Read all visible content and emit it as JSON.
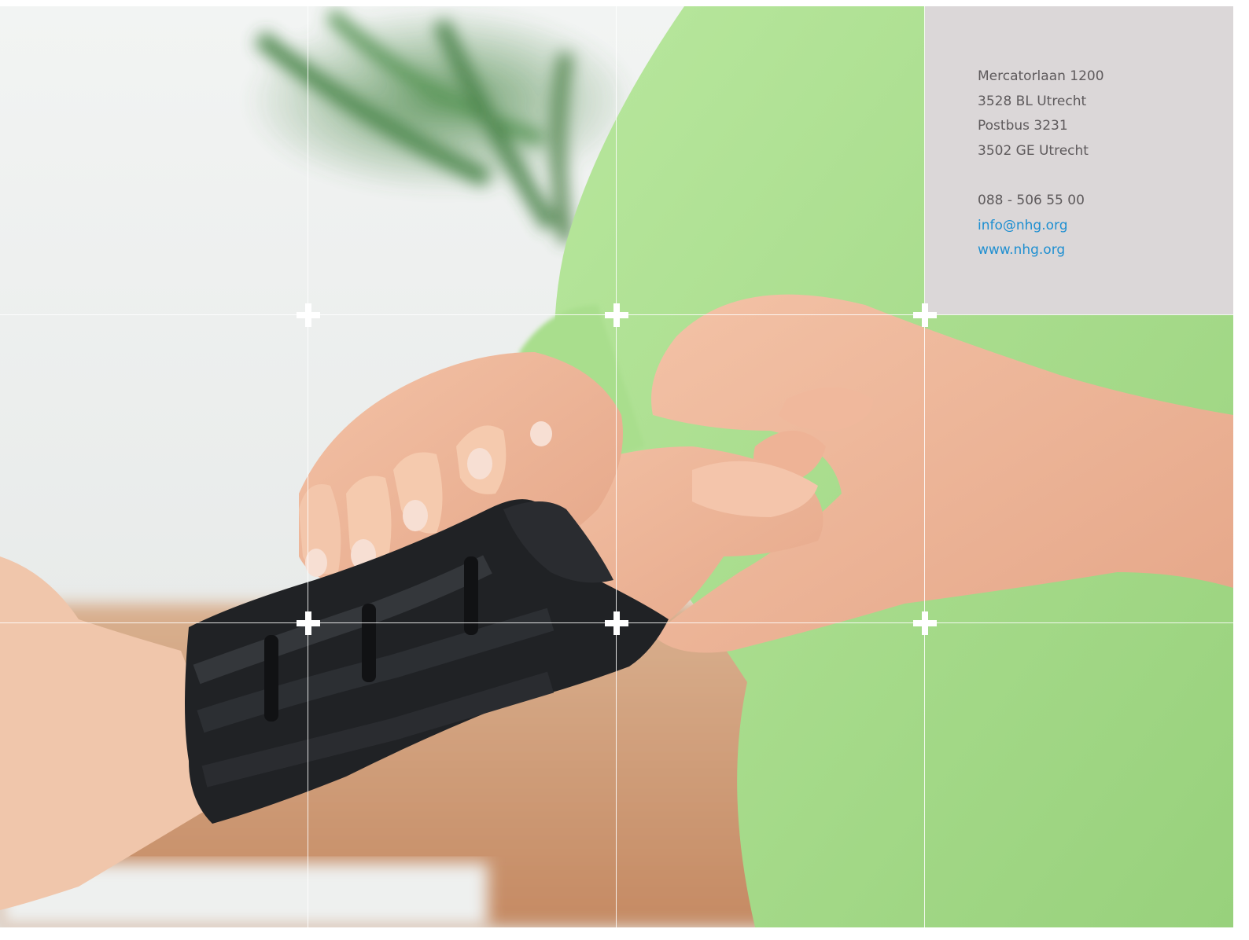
{
  "contact": {
    "street": "Mercatorlaan 1200",
    "postal_city": "3528 BL Utrecht",
    "po_box": "Postbus 3231",
    "po_box_city": "3502 GE Utrecht",
    "phone": "088 - 506 55 00",
    "email": "info@nhg.org",
    "website": "www.nhg.org"
  },
  "colors": {
    "panel_background": "#dbd7d8",
    "body_text": "#5e5a5c",
    "link": "#1e8fd1",
    "shirt_green": "#a6dc8a"
  }
}
